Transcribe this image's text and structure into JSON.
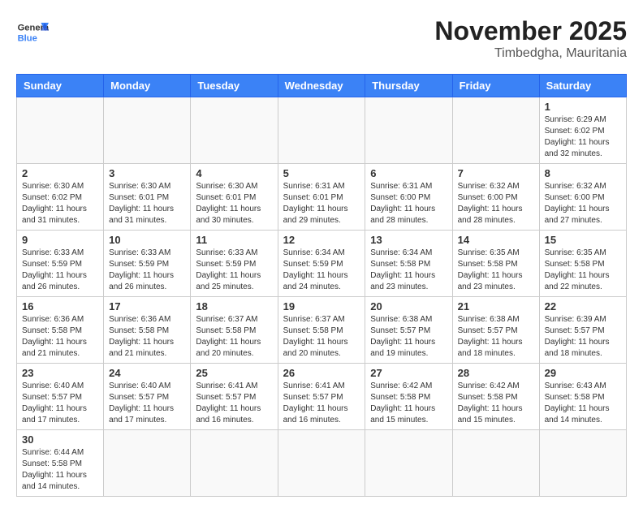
{
  "header": {
    "logo_general": "General",
    "logo_blue": "Blue",
    "month": "November 2025",
    "location": "Timbedgha, Mauritania"
  },
  "days_of_week": [
    "Sunday",
    "Monday",
    "Tuesday",
    "Wednesday",
    "Thursday",
    "Friday",
    "Saturday"
  ],
  "weeks": [
    [
      {
        "day": "",
        "info": ""
      },
      {
        "day": "",
        "info": ""
      },
      {
        "day": "",
        "info": ""
      },
      {
        "day": "",
        "info": ""
      },
      {
        "day": "",
        "info": ""
      },
      {
        "day": "",
        "info": ""
      },
      {
        "day": "1",
        "info": "Sunrise: 6:29 AM\nSunset: 6:02 PM\nDaylight: 11 hours\nand 32 minutes."
      }
    ],
    [
      {
        "day": "2",
        "info": "Sunrise: 6:30 AM\nSunset: 6:02 PM\nDaylight: 11 hours\nand 31 minutes."
      },
      {
        "day": "3",
        "info": "Sunrise: 6:30 AM\nSunset: 6:01 PM\nDaylight: 11 hours\nand 31 minutes."
      },
      {
        "day": "4",
        "info": "Sunrise: 6:30 AM\nSunset: 6:01 PM\nDaylight: 11 hours\nand 30 minutes."
      },
      {
        "day": "5",
        "info": "Sunrise: 6:31 AM\nSunset: 6:01 PM\nDaylight: 11 hours\nand 29 minutes."
      },
      {
        "day": "6",
        "info": "Sunrise: 6:31 AM\nSunset: 6:00 PM\nDaylight: 11 hours\nand 28 minutes."
      },
      {
        "day": "7",
        "info": "Sunrise: 6:32 AM\nSunset: 6:00 PM\nDaylight: 11 hours\nand 28 minutes."
      },
      {
        "day": "8",
        "info": "Sunrise: 6:32 AM\nSunset: 6:00 PM\nDaylight: 11 hours\nand 27 minutes."
      }
    ],
    [
      {
        "day": "9",
        "info": "Sunrise: 6:33 AM\nSunset: 5:59 PM\nDaylight: 11 hours\nand 26 minutes."
      },
      {
        "day": "10",
        "info": "Sunrise: 6:33 AM\nSunset: 5:59 PM\nDaylight: 11 hours\nand 26 minutes."
      },
      {
        "day": "11",
        "info": "Sunrise: 6:33 AM\nSunset: 5:59 PM\nDaylight: 11 hours\nand 25 minutes."
      },
      {
        "day": "12",
        "info": "Sunrise: 6:34 AM\nSunset: 5:59 PM\nDaylight: 11 hours\nand 24 minutes."
      },
      {
        "day": "13",
        "info": "Sunrise: 6:34 AM\nSunset: 5:58 PM\nDaylight: 11 hours\nand 23 minutes."
      },
      {
        "day": "14",
        "info": "Sunrise: 6:35 AM\nSunset: 5:58 PM\nDaylight: 11 hours\nand 23 minutes."
      },
      {
        "day": "15",
        "info": "Sunrise: 6:35 AM\nSunset: 5:58 PM\nDaylight: 11 hours\nand 22 minutes."
      }
    ],
    [
      {
        "day": "16",
        "info": "Sunrise: 6:36 AM\nSunset: 5:58 PM\nDaylight: 11 hours\nand 21 minutes."
      },
      {
        "day": "17",
        "info": "Sunrise: 6:36 AM\nSunset: 5:58 PM\nDaylight: 11 hours\nand 21 minutes."
      },
      {
        "day": "18",
        "info": "Sunrise: 6:37 AM\nSunset: 5:58 PM\nDaylight: 11 hours\nand 20 minutes."
      },
      {
        "day": "19",
        "info": "Sunrise: 6:37 AM\nSunset: 5:58 PM\nDaylight: 11 hours\nand 20 minutes."
      },
      {
        "day": "20",
        "info": "Sunrise: 6:38 AM\nSunset: 5:57 PM\nDaylight: 11 hours\nand 19 minutes."
      },
      {
        "day": "21",
        "info": "Sunrise: 6:38 AM\nSunset: 5:57 PM\nDaylight: 11 hours\nand 18 minutes."
      },
      {
        "day": "22",
        "info": "Sunrise: 6:39 AM\nSunset: 5:57 PM\nDaylight: 11 hours\nand 18 minutes."
      }
    ],
    [
      {
        "day": "23",
        "info": "Sunrise: 6:40 AM\nSunset: 5:57 PM\nDaylight: 11 hours\nand 17 minutes."
      },
      {
        "day": "24",
        "info": "Sunrise: 6:40 AM\nSunset: 5:57 PM\nDaylight: 11 hours\nand 17 minutes."
      },
      {
        "day": "25",
        "info": "Sunrise: 6:41 AM\nSunset: 5:57 PM\nDaylight: 11 hours\nand 16 minutes."
      },
      {
        "day": "26",
        "info": "Sunrise: 6:41 AM\nSunset: 5:57 PM\nDaylight: 11 hours\nand 16 minutes."
      },
      {
        "day": "27",
        "info": "Sunrise: 6:42 AM\nSunset: 5:58 PM\nDaylight: 11 hours\nand 15 minutes."
      },
      {
        "day": "28",
        "info": "Sunrise: 6:42 AM\nSunset: 5:58 PM\nDaylight: 11 hours\nand 15 minutes."
      },
      {
        "day": "29",
        "info": "Sunrise: 6:43 AM\nSunset: 5:58 PM\nDaylight: 11 hours\nand 14 minutes."
      }
    ],
    [
      {
        "day": "30",
        "info": "Sunrise: 6:44 AM\nSunset: 5:58 PM\nDaylight: 11 hours\nand 14 minutes."
      },
      {
        "day": "",
        "info": ""
      },
      {
        "day": "",
        "info": ""
      },
      {
        "day": "",
        "info": ""
      },
      {
        "day": "",
        "info": ""
      },
      {
        "day": "",
        "info": ""
      },
      {
        "day": "",
        "info": ""
      }
    ]
  ]
}
